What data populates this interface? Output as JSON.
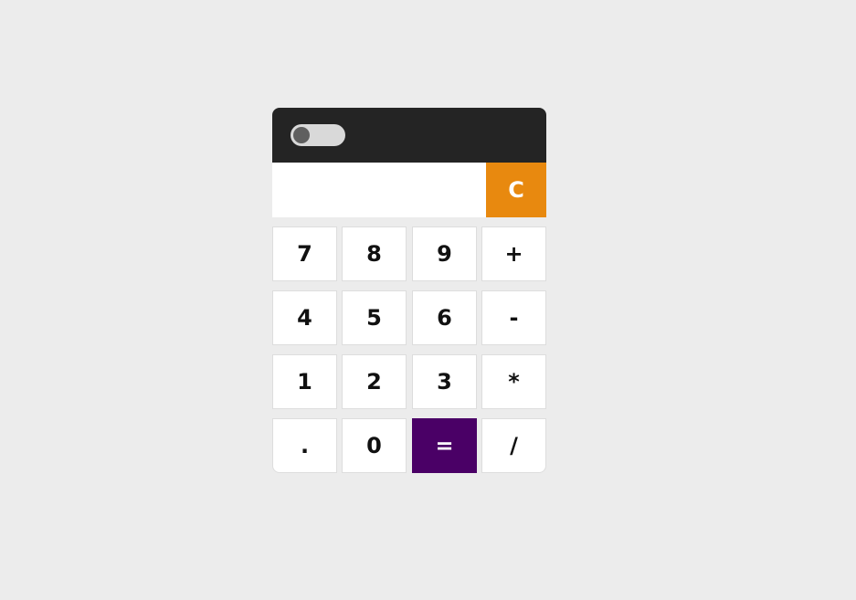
{
  "colors": {
    "background": "#ececec",
    "header": "#242424",
    "toggle_track": "#d9d9d9",
    "toggle_knob": "#5f5f5f",
    "clear_button": "#e8890f",
    "equals_button": "#4a0066",
    "key": "#ffffff"
  },
  "header": {
    "theme_toggle": {
      "on": false
    }
  },
  "display": {
    "value": "",
    "placeholder": ""
  },
  "clear": {
    "label": "C"
  },
  "keys": {
    "seven": "7",
    "eight": "8",
    "nine": "9",
    "plus": "+",
    "four": "4",
    "five": "5",
    "six": "6",
    "minus": "-",
    "one": "1",
    "two": "2",
    "three": "3",
    "multiply": "*",
    "dot": ".",
    "zero": "0",
    "equals": "=",
    "divide": "/"
  }
}
